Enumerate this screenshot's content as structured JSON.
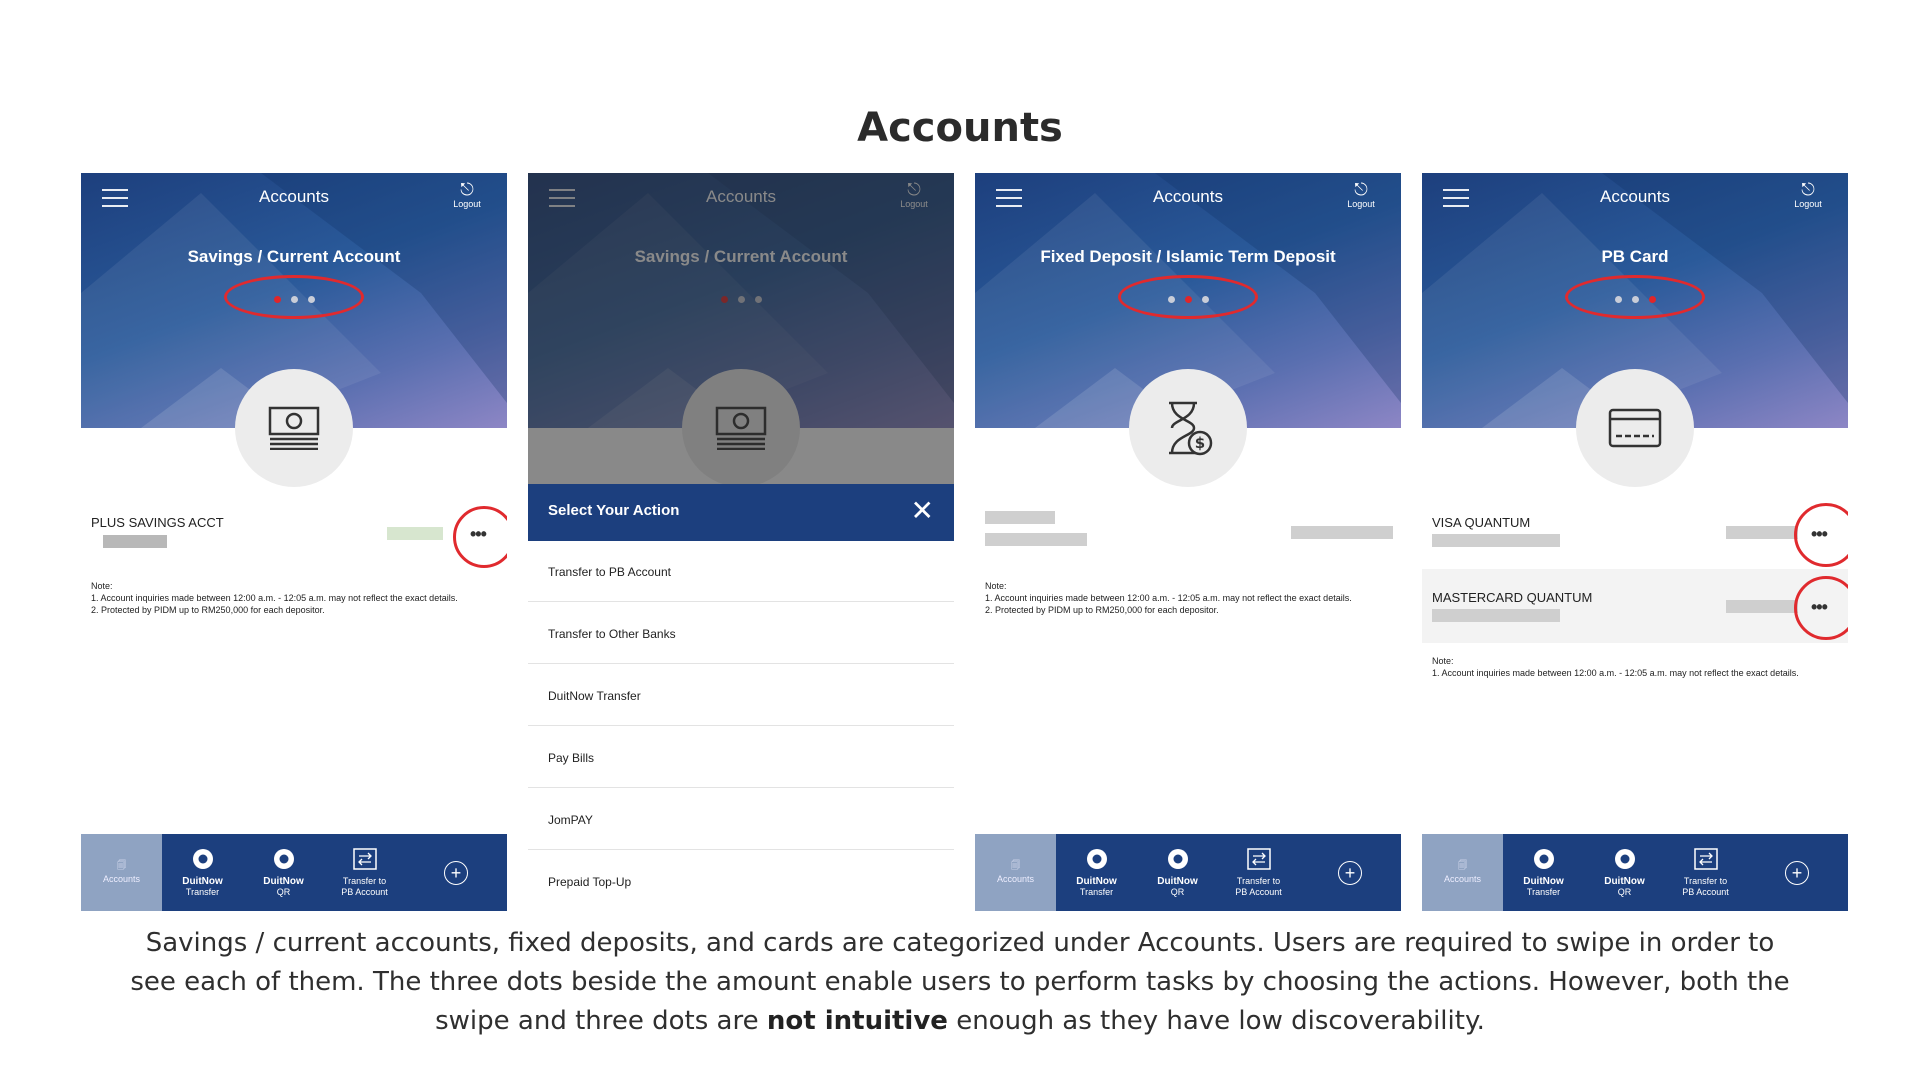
{
  "slide_title": "Accounts",
  "caption": {
    "part1": "Savings / current accounts, fixed deposits, and cards are categorized under Accounts. Users are required to swipe in order to see each of them. The three dots beside the amount enable users to perform tasks by choosing the actions. However, both the swipe and three dots are ",
    "bold": "not intuitive",
    "part2": " enough as they have low discoverability."
  },
  "header": {
    "title": "Accounts",
    "logout": "Logout"
  },
  "panels": [
    {
      "account_type": "Savings / Current Account",
      "active_dot": 0,
      "icon": "cash-icon",
      "account_name": "PLUS SAVINGS ACCT",
      "note": [
        "Note:",
        "1. Account inquiries made between 12:00 a.m. - 12:05 a.m. may not reflect the exact details.",
        "2. Protected by PIDM up to RM250,000 for each depositor."
      ]
    },
    {
      "account_type": "Savings / Current Account",
      "active_dot": 0,
      "icon": "cash-icon",
      "sheet_title": "Select Your Action",
      "actions": [
        "Transfer to PB Account",
        "Transfer to Other Banks",
        "DuitNow Transfer",
        "Pay Bills",
        "JomPAY",
        "Prepaid Top-Up"
      ]
    },
    {
      "account_type": "Fixed Deposit / Islamic Term Deposit",
      "active_dot": 1,
      "icon": "hourglass-dollar-icon",
      "note": [
        "Note:",
        "1. Account inquiries made between 12:00 a.m. - 12:05 a.m. may not reflect the exact details.",
        "2. Protected by PIDM up to RM250,000 for each depositor."
      ]
    },
    {
      "account_type": "PB Card",
      "active_dot": 2,
      "icon": "credit-card-icon",
      "cards": [
        "VISA QUANTUM",
        "MASTERCARD QUANTUM"
      ],
      "note": [
        "Note:",
        "1. Account inquiries made between 12:00 a.m. - 12:05 a.m. may not reflect the exact details."
      ]
    }
  ],
  "more_label": "•••",
  "bottom_nav": {
    "accounts": "Accounts",
    "duitnow": "DuitNow",
    "transfer": "Transfer",
    "qr": "QR",
    "transfer_to": "Transfer to",
    "pb_account": "PB Account",
    "plus": "+"
  },
  "colors": {
    "brand_navy": "#1c3f7e",
    "highlight_red": "#e02a2e",
    "active_dot": "#e0262a"
  }
}
